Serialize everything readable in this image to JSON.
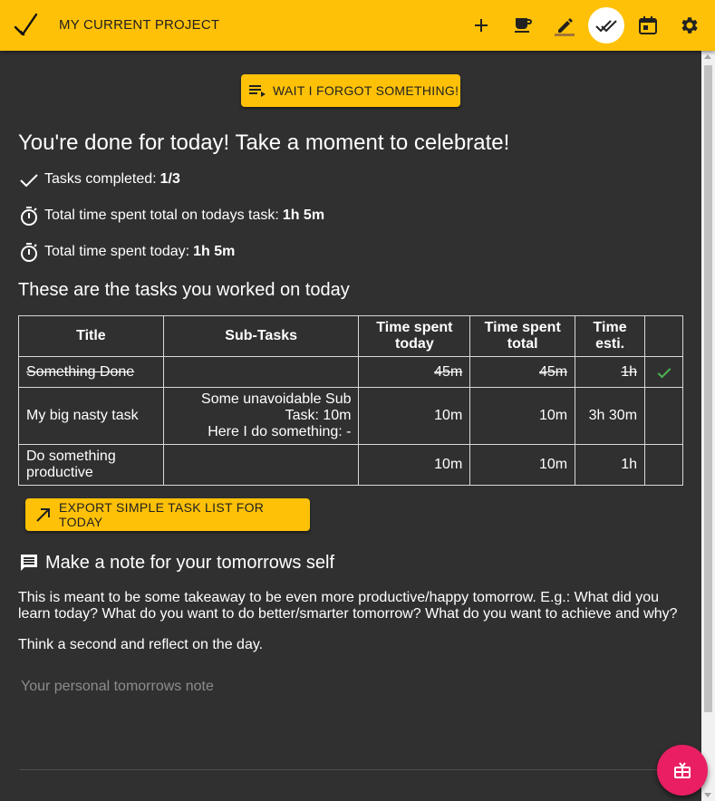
{
  "header": {
    "project_title": "MY CURRENT PROJECT",
    "accent_color": "#ffc107",
    "buttons": [
      {
        "icon": "plus-icon",
        "name": "add-task-button"
      },
      {
        "icon": "coffee-icon",
        "name": "take-break-button"
      },
      {
        "icon": "pencil-icon",
        "name": "work-view-button"
      },
      {
        "icon": "done-all-icon",
        "name": "daily-summary-button",
        "active": true
      },
      {
        "icon": "calendar-icon",
        "name": "schedule-button"
      },
      {
        "icon": "gear-icon",
        "name": "settings-button"
      }
    ]
  },
  "summary": {
    "forgot_button_label": "WAIT I FORGOT SOMETHING!",
    "headline": "You're done for today! Take a moment to celebrate!",
    "stats": [
      {
        "icon": "check-icon",
        "label": "Tasks completed:",
        "value": "1/3"
      },
      {
        "icon": "timer-icon",
        "label": "Total time spent total on todays task:",
        "value": "1h 5m"
      },
      {
        "icon": "timer-icon",
        "label": "Total time spent today:",
        "value": "1h 5m"
      }
    ],
    "tasks_heading": "These are the tasks you worked on today"
  },
  "table": {
    "headers": {
      "title": "Title",
      "sub_tasks": "Sub-Tasks",
      "time_today_1": "Time spent",
      "time_today_2": "today",
      "time_total_1": "Time spent",
      "time_total_2": "total",
      "estimate_1": "Time",
      "estimate_2": "esti."
    },
    "rows": [
      {
        "title": "Something Done",
        "sub_line_1": "",
        "sub_line_2": "",
        "sub_line_3": "",
        "today": "45m",
        "total": "45m",
        "estimate": "1h",
        "done": true
      },
      {
        "title": "My big nasty task",
        "sub_line_1": "Some unavoidable Sub",
        "sub_line_2": "Task: 10m",
        "sub_line_3": "Here I do something: -",
        "today": "10m",
        "total": "10m",
        "estimate": "3h 30m",
        "done": false
      },
      {
        "title_line_1": "Do something",
        "title_line_2": "productive",
        "today": "10m",
        "total": "10m",
        "estimate": "1h",
        "done": false
      }
    ],
    "done_check_color": "#4caf50"
  },
  "export": {
    "button_label": "EXPORT SIMPLE TASK LIST FOR TODAY"
  },
  "note": {
    "heading": "Make a note for your tomorrows self",
    "paragraph_1": "This is meant to be some takeaway to be even more productive/happy tomorrow. E.g.: What did you learn today? What do you want to do better/smarter tomorrow? What do you want to achieve and why?",
    "paragraph_2": "Think a second and reflect on the day.",
    "placeholder": "Your personal tomorrows note",
    "value": ""
  },
  "fab": {
    "icon": "gift-icon",
    "color": "#e91e63"
  }
}
